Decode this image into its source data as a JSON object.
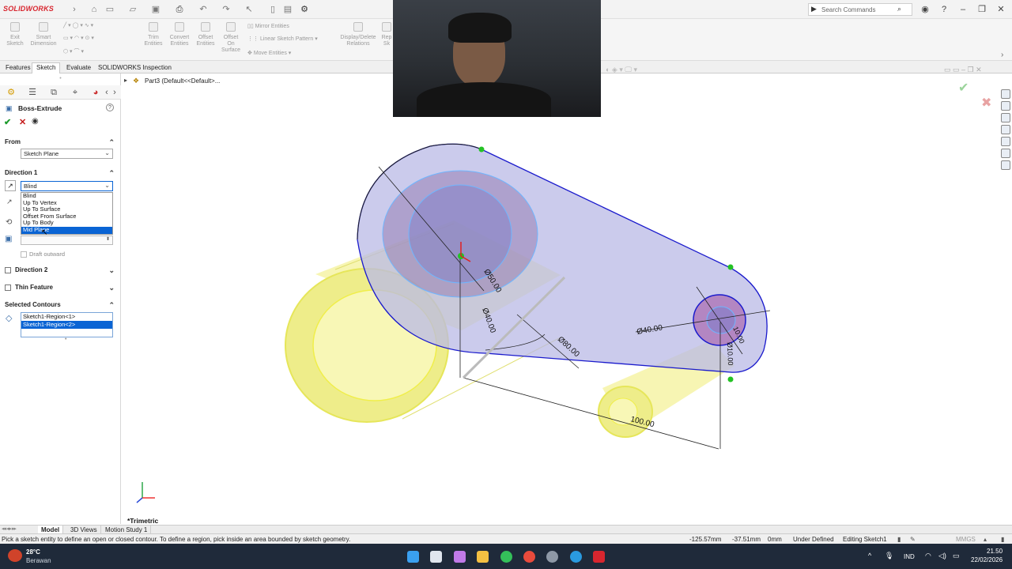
{
  "app": {
    "brand": "SOLIDWORKS"
  },
  "search": {
    "placeholder": "Search Commands"
  },
  "command_manager": {
    "exit_sketch": "Exit Sketch",
    "smart_dimension": "Smart Dimension",
    "trim_entities": "Trim Entities",
    "convert_entities": "Convert Entities",
    "offset_entities": "Offset Entities",
    "offset_on_surface": "Offset On Surface",
    "mirror_entities": "Mirror Entities",
    "linear_sketch_pattern": "Linear Sketch Pattern",
    "move_entities": "Move Entities",
    "display_delete_relations": "Display/Delete Relations",
    "repair_sketch": "Rep Sk"
  },
  "tabs": [
    "Features",
    "Sketch",
    "Evaluate",
    "SOLIDWORKS Inspection"
  ],
  "active_tab": "Sketch",
  "feature_tree": {
    "root": "Part3  (Default<<Default>..."
  },
  "property_manager": {
    "title": "Boss-Extrude",
    "from_section": "From",
    "from_value": "Sketch Plane",
    "direction1_section": "Direction 1",
    "direction1_value": "Blind",
    "end_condition_options": [
      "Blind",
      "Up To Vertex",
      "Up To Surface",
      "Offset From Surface",
      "Up To Body",
      "Mid Plane"
    ],
    "highlighted_option": "Mid Plane",
    "draft_outward": "Draft outward",
    "direction2_section": "Direction 2",
    "thin_feature_section": "Thin Feature",
    "selected_contours_section": "Selected Contours",
    "contours": [
      "Sketch1-Region<1>",
      "Sketch1-Region<2>"
    ]
  },
  "dimensions": {
    "d1": "Ø50.00",
    "d2": "Ø40.00",
    "d3": "Ø80.00",
    "d4": "Ø40.00",
    "d5": "10.00",
    "d6": "Ø10.00",
    "d7": "100.00"
  },
  "view": {
    "name": "*Trimetric"
  },
  "bottom_tabs": [
    "Model",
    "3D Views",
    "Motion Study 1"
  ],
  "status": {
    "message": "Pick a sketch entity to define an open or closed contour. To define a region, pick inside an area bounded by sketch geometry.",
    "x": "-125.57mm",
    "y": "-37.51mm",
    "z": "0mm",
    "state": "Under Defined",
    "editing": "Editing Sketch1",
    "units": "MMGS"
  },
  "taskbar": {
    "temperature": "28°C",
    "weather": "Berawan",
    "language": "IND",
    "time": "21.50",
    "date": "22/02/2026"
  },
  "colors": {
    "selection_blue": "#0a64d4",
    "body_yellow": "#f4f29a",
    "sketch_blue": "#1a1acc",
    "taskbar": "#1f2a3a"
  }
}
